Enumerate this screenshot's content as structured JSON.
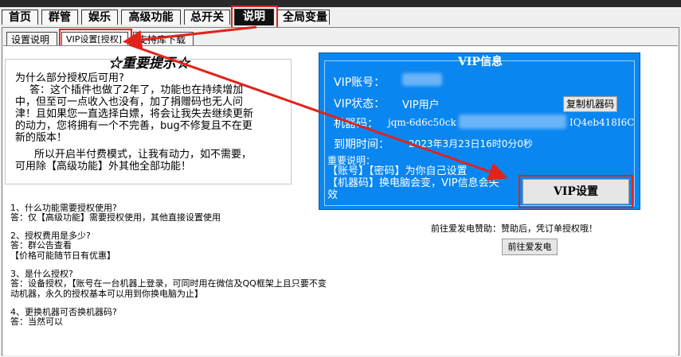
{
  "nav": {
    "tabs": [
      {
        "label": "首页"
      },
      {
        "label": "群管"
      },
      {
        "label": "娱乐"
      },
      {
        "label": "高级功能"
      },
      {
        "label": "总开关"
      },
      {
        "label": "说明"
      },
      {
        "label": "全局变量"
      }
    ],
    "active": "说明"
  },
  "subnav": {
    "tabs": [
      {
        "label": "设置说明"
      },
      {
        "label": "VIP设置[授权]"
      },
      {
        "label": "支持库下载"
      }
    ],
    "active": "VIP设置[授权]"
  },
  "notice": {
    "title": "☆重要提示☆",
    "question": "为什么部分授权后可用?",
    "answer_lines": [
      "答：这个插件也做了2年了，功能也在持续增加",
      "中，但至可一点收入也没有，加了捐赠码也无人问",
      "津！且如果您一直选择白嫖，将会让我失去继续更新",
      "的动力，您将拥有一个不完善，bug不修复且不在更",
      "新的版本！"
    ],
    "closing_lines": [
      "所以开启半付费模式，让我有动力，如不需要，",
      "可用除【高级功能】外其他全部功能！"
    ]
  },
  "faq": [
    {
      "q": "1、什么功能需要授权使用?",
      "a": "答：仅【高级功能】需要授权使用，其他直接设置使用"
    },
    {
      "q": "2、授权费用是多少?",
      "a": "答：群公告查看\n【价格可能随节日有优惠】"
    },
    {
      "q": "3、是什么授权?",
      "a": "答：设备授权，【账号在一台机器上登录，可同时用在微信及QQ框架上且只要不变\n动机器，永久的授权基本可以用到你换电脑为止】"
    },
    {
      "q": "4、更换机器可否换机器码?",
      "a": "答：当然可以"
    }
  ],
  "vip": {
    "title": "VIP信息",
    "account_label": "VIP账号：",
    "status_label": "VIP状态：",
    "status_value": "VIP用户",
    "machine_label": "机器码：",
    "machine_prefix": "jqm-6d6c50ck",
    "machine_suffix": "IQ4eb418I6C",
    "expiry_label": "到期时间：",
    "expiry_value": "2023年3月23日16时0分0秒",
    "copy_button": "复制机器码",
    "note_title": "重要说明：",
    "note_lines": [
      "【账号】【密码】为你自己设置",
      "【机器码】换电脑会变，VIP信息会失",
      "效"
    ],
    "settings_button": "VIP设置"
  },
  "sponsor": {
    "text": "前往爱发电赞助：赞助后，凭订单授权哦！",
    "button": "前往爱发电"
  },
  "colors": {
    "vip_panel": "#0a86f0",
    "annotation_red": "#e0231b",
    "active_tab": "#111111"
  }
}
